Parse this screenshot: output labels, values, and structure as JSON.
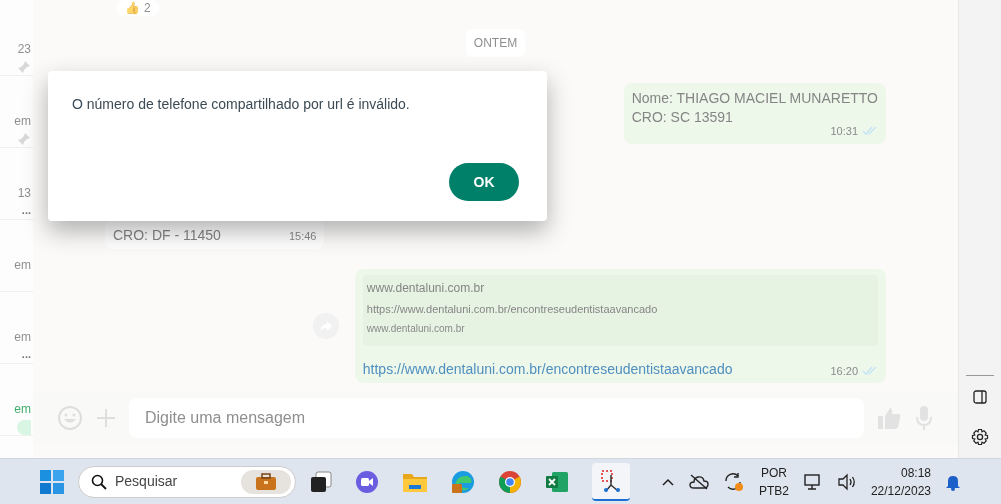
{
  "sidebar": {
    "items": [
      {
        "time": "23",
        "pinned": true
      },
      {
        "time": "em",
        "pinned": true
      },
      {
        "time": "13",
        "preview": "..."
      },
      {
        "time": "em"
      },
      {
        "time": "em",
        "preview": "..."
      },
      {
        "time": "em",
        "unread": true
      }
    ]
  },
  "chat": {
    "reaction": {
      "emoji": "👍",
      "count": "2"
    },
    "date_label": "ONTEM",
    "messages": [
      {
        "kind": "text",
        "outgoing": true,
        "lines": [
          "Nome: THIAGO MACIEL MUNARETTO",
          "CRO: SC 13591"
        ],
        "time": "10:31",
        "read": true
      },
      {
        "kind": "text",
        "outgoing": false,
        "lines": [
          "CRO: DF - 11450"
        ],
        "time": "15:46"
      },
      {
        "kind": "link",
        "outgoing": true,
        "preview_title": "www.dentaluni.com.br",
        "preview_url": "https://www.dentaluni.com.br/encontreseudentistaavancado",
        "preview_domain": "www.dentaluni.com.br",
        "lines": [
          "https://www.dentaluni.com.br/encontreseudentistaavancado"
        ],
        "time": "16:20",
        "read": true
      }
    ],
    "composer": {
      "placeholder": "Digite uma mensagem"
    }
  },
  "dialog": {
    "message": "O número de telefone compartilhado por url é inválido.",
    "button": "OK"
  },
  "taskbar": {
    "search_placeholder": "Pesquisar",
    "language": "POR",
    "layout": "PTB2",
    "time": "08:18",
    "date": "22/12/2023"
  }
}
